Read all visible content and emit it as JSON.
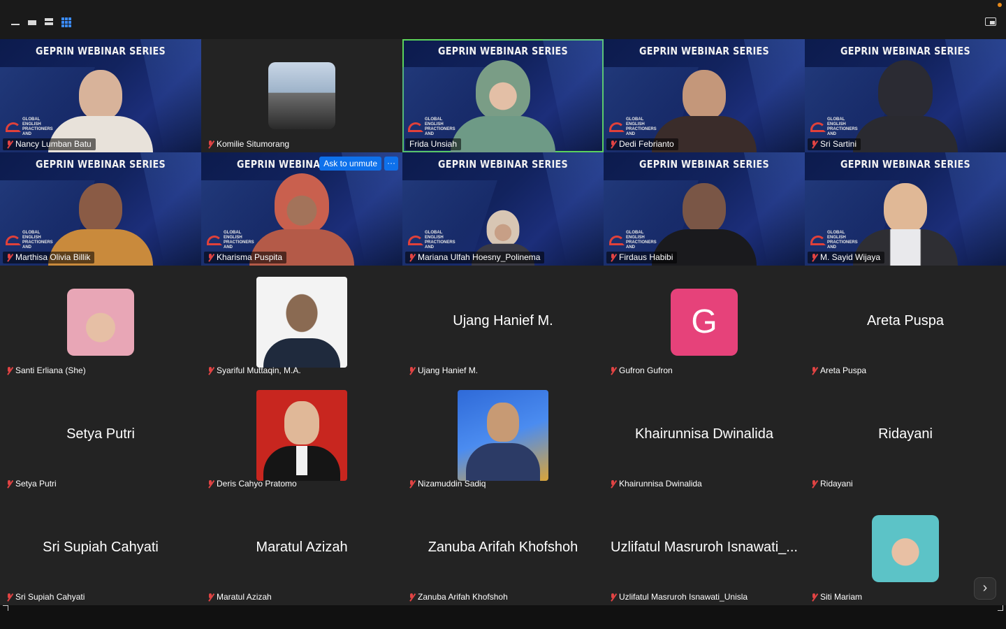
{
  "toolbar": {
    "layouts": [
      "minimize-view",
      "speaker-view",
      "stacked-view",
      "gallery-view"
    ]
  },
  "banner_text": "GEPRIN WEBINAR SERIES",
  "logo_text": "GLOBAL ENGLISH PRACTIONERS AND",
  "colors": {
    "accent": "#0e71eb",
    "active_speaker": "#5bd35b",
    "muted": "#e04343",
    "letter_avatar": "#e6427a"
  },
  "participants": [
    {
      "name": "Nancy Lumban Batu"
    },
    {
      "name": "Komilie Situmorang"
    },
    {
      "name": "Frida Unsiah"
    },
    {
      "name": "Dedi Febrianto"
    },
    {
      "name": "Sri Sartini"
    },
    {
      "name": "Marthisa Olivia Billik"
    },
    {
      "name": "Kharisma Puspita"
    },
    {
      "name": "Mariana Ulfah Hoesny_Polinema"
    },
    {
      "name": "Firdaus Habibi"
    },
    {
      "name": "M. Sayid Wijaya"
    },
    {
      "name": "Santi Erliana (She)"
    },
    {
      "name": "Syariful Muttaqin, M.A."
    },
    {
      "name": "Ujang Hanief M.",
      "display": "Ujang Hanief M."
    },
    {
      "name": "Gufron Gufron",
      "letter": "G"
    },
    {
      "name": "Areta Puspa",
      "display": "Areta Puspa"
    },
    {
      "name": "Setya Putri",
      "display": "Setya Putri"
    },
    {
      "name": "Deris Cahyo Pratomo"
    },
    {
      "name": "Nizamuddin Sadiq"
    },
    {
      "name": "Khairunnisa Dwinalida",
      "display": "Khairunnisa Dwinalida"
    },
    {
      "name": "Ridayani",
      "display": "Ridayani"
    },
    {
      "name": "Sri Supiah Cahyati",
      "display": "Sri Supiah Cahyati"
    },
    {
      "name": "Maratul Azizah",
      "display": "Maratul Azizah"
    },
    {
      "name": "Zanuba Arifah Khofshoh",
      "display": "Zanuba Arifah Khofshoh"
    },
    {
      "name": "Uzlifatul Masruroh Isnawati_Unisla",
      "display": "Uzlifatul Masruroh Isnawati_..."
    },
    {
      "name": "Siti Mariam"
    }
  ],
  "tile_actions": {
    "ask_to_unmute": "Ask to unmute",
    "more": "···"
  },
  "navigation": {
    "next_page": "›"
  }
}
